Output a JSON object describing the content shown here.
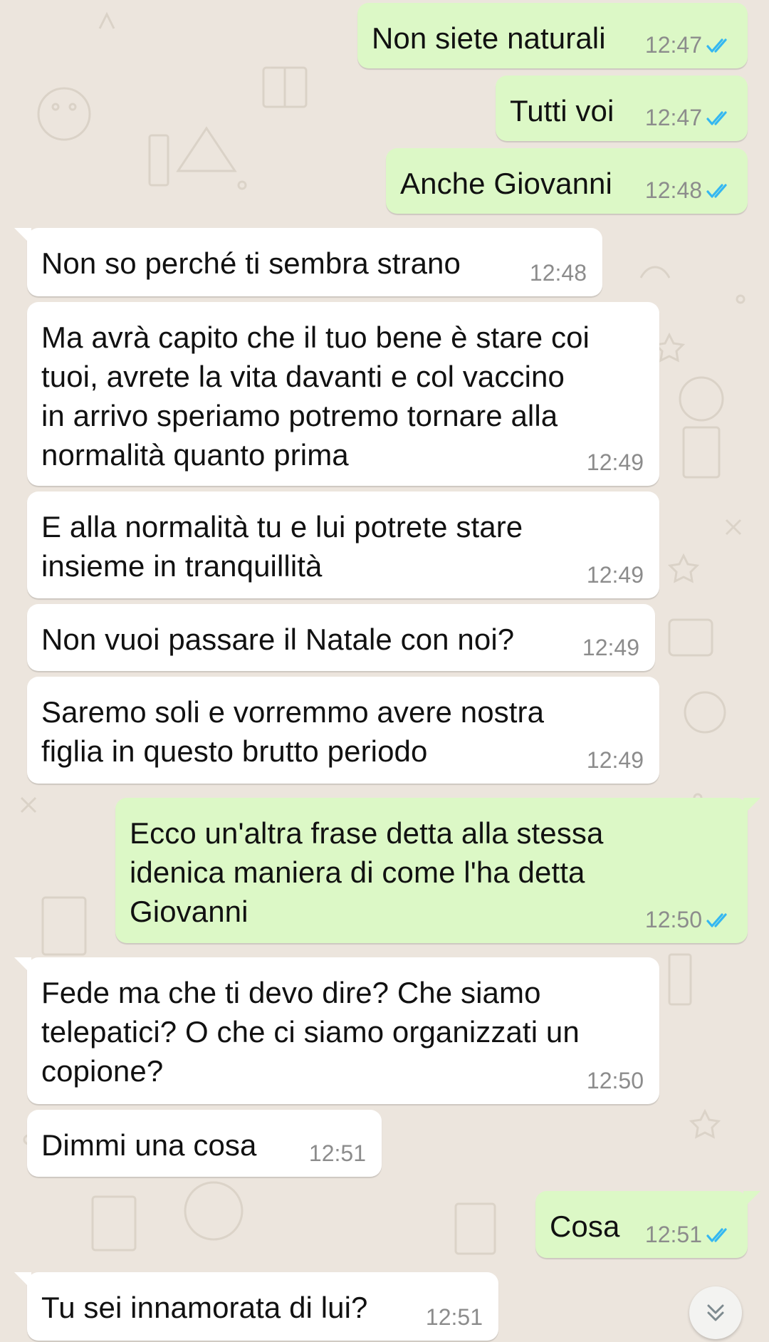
{
  "colors": {
    "wallpaper": "#ece5dd",
    "incoming_bubble": "#ffffff",
    "outgoing_bubble": "#dcf8c6",
    "read_ticks": "#34b7f1",
    "timestamp": "#8c8c8c"
  },
  "messages": [
    {
      "dir": "out",
      "text": "Non siete naturali",
      "time": "12:47",
      "status_icon": "double-check-read-icon"
    },
    {
      "dir": "out",
      "text": "Tutti voi",
      "time": "12:47",
      "status_icon": "double-check-read-icon"
    },
    {
      "dir": "out",
      "text": "Anche Giovanni",
      "time": "12:48",
      "status_icon": "double-check-read-icon"
    },
    {
      "dir": "in",
      "text": "Non so perché ti sembra strano",
      "time": "12:48"
    },
    {
      "dir": "in",
      "text": "Ma avrà capito che il tuo bene è stare coi\ntuoi, avrete la vita davanti e col vaccino\nin arrivo speriamo potremo tornare alla\nnormalità quanto prima",
      "time": "12:49"
    },
    {
      "dir": "in",
      "text": "E alla normalità tu e lui potrete stare\ninsieme in tranquillità",
      "time": "12:49"
    },
    {
      "dir": "in",
      "text": "Non vuoi passare il Natale con noi?",
      "time": "12:49"
    },
    {
      "dir": "in",
      "text": "Saremo soli e vorremmo avere nostra\nfiglia in questo brutto periodo",
      "time": "12:49"
    },
    {
      "dir": "out",
      "text": "Ecco un'altra frase detta alla stessa\nidenica maniera di come l'ha detta\nGiovanni",
      "time": "12:50",
      "status_icon": "double-check-read-icon"
    },
    {
      "dir": "in",
      "text": "Fede ma che ti devo dire? Che siamo\ntelepatici? O che ci siamo organizzati un\ncopione?",
      "time": "12:50"
    },
    {
      "dir": "in",
      "text": "Dimmi una cosa",
      "time": "12:51"
    },
    {
      "dir": "out",
      "text": "Cosa",
      "time": "12:51",
      "status_icon": "double-check-read-icon"
    },
    {
      "dir": "in",
      "text": "Tu sei innamorata di lui?",
      "time": "12:51"
    }
  ],
  "scroll_button": {
    "icon": "double-chevron-down-icon"
  }
}
